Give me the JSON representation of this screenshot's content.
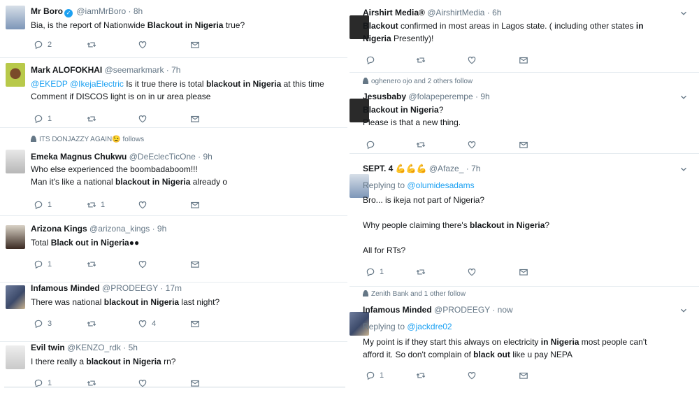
{
  "left": {
    "tweets": [
      {
        "name": "Mr Boro",
        "handle": "@iamMrBoro",
        "time": "8h",
        "verified": true,
        "lines": [
          [
            "Bia, is the report of Nationwide ",
            [
              "Blackout in Nigeria"
            ],
            " true?"
          ]
        ],
        "reply": "2",
        "retweet": "",
        "like": ""
      },
      {
        "name": "Mark ALOFOKHAI",
        "handle": "@seemarkmark",
        "time": "7h",
        "lines": [
          [
            [
              "@EKEDP",
              "m"
            ],
            " ",
            [
              "@IkejaElectric",
              "m"
            ],
            " Is it true there is total ",
            [
              "blackout in Nigeria"
            ],
            " at this time"
          ],
          [
            "Comment if DISCOS light is on in ur area please"
          ]
        ],
        "reply": "1",
        "retweet": "",
        "like": ""
      },
      {
        "social": "ITS DONJAZZY AGAIN😉 follows",
        "name": "Emeka Magnus Chukwu",
        "handle": "@DeEclecTicOne",
        "time": "9h",
        "lines": [
          [
            "Who else experienced the boombadaboom!!!"
          ],
          [
            "Man it's like a national ",
            [
              "blackout in Nigeria"
            ],
            " already o"
          ]
        ],
        "reply": "1",
        "retweet": "1",
        "like": ""
      },
      {
        "name": "Arizona Kings",
        "handle": "@arizona_kings",
        "time": "9h",
        "lines": [
          [
            "Total ",
            [
              "Black out in Nigeria"
            ],
            "●●"
          ]
        ],
        "reply": "1",
        "retweet": "",
        "like": ""
      },
      {
        "name": "Infamous Minded",
        "handle": "@PRODEEGY",
        "time": "17m",
        "lines": [
          [
            "There was national ",
            [
              "blackout in Nigeria"
            ],
            " last night?"
          ]
        ],
        "reply": "3",
        "retweet": "",
        "like": "4"
      },
      {
        "name": "Evil twin",
        "handle": "@KENZO_rdk",
        "time": "5h",
        "lines": [
          [
            "I there really a ",
            [
              "blackout in Nigeria"
            ],
            " rn?"
          ]
        ],
        "reply": "1",
        "retweet": "",
        "like": ""
      }
    ]
  },
  "right": {
    "tweets": [
      {
        "name": "Airshirt Media®",
        "handle": "@AirshirtMedia",
        "time": "6h",
        "lines": [
          [
            [
              "Blackout"
            ],
            " confirmed in most areas in Lagos state. ( including other states ",
            [
              "in"
            ]
          ],
          [
            [
              "Nigeria"
            ],
            " Presently)!"
          ]
        ],
        "reply": "",
        "retweet": "",
        "like": ""
      },
      {
        "social": "oghenero ojo and 2 others follow",
        "name": "Jesusbaby",
        "handle": "@folapeperempe",
        "time": "9h",
        "lines": [
          [
            [
              "Blackout in Nigeria"
            ],
            "?"
          ],
          [
            "Please is that a new thing."
          ]
        ],
        "reply": "",
        "retweet": "",
        "like": ""
      },
      {
        "name": "SEPT. 4 💪💪💪",
        "handle": "@Afaze_",
        "time": "7h",
        "replying_label": "Replying to",
        "replying_to": "@olumidesadams",
        "lines": [
          [
            "Bro... is ikeja not part of Nigeria?"
          ],
          [
            ""
          ],
          [
            "Why people claiming there's ",
            [
              "blackout in Nigeria"
            ],
            "?"
          ],
          [
            ""
          ],
          [
            "All for RTs?"
          ]
        ],
        "reply": "1",
        "retweet": "",
        "like": ""
      },
      {
        "social": "Zenith Bank and 1 other follow",
        "name": "Infamous Minded",
        "handle": "@PRODEEGY",
        "time": "now",
        "replying_label": "Replying to",
        "replying_to": "@jackdre02",
        "lines": [
          [
            "My point is if they start this always on electricity ",
            [
              "in Nigeria"
            ],
            " most people can't"
          ],
          [
            "afford it. So don't complain of ",
            [
              "black out"
            ],
            " like u pay NEPA"
          ]
        ],
        "reply": "1",
        "retweet": "",
        "like": ""
      }
    ]
  }
}
